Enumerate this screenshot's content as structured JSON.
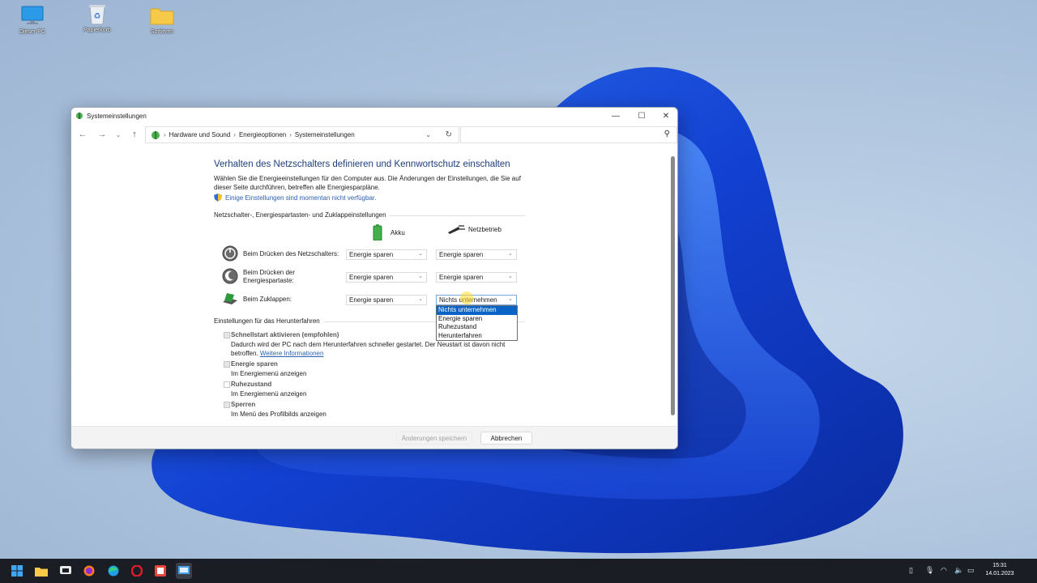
{
  "desktop": {
    "icons": [
      {
        "label": "Dieser PC"
      },
      {
        "label": "Papierkorb"
      },
      {
        "label": "Sortieren"
      }
    ]
  },
  "window": {
    "title": "Systemeinstellungen",
    "breadcrumb": [
      "Hardware und Sound",
      "Energieoptionen",
      "Systemeinstellungen"
    ],
    "search_placeholder": ""
  },
  "page": {
    "heading": "Verhalten des Netzschalters definieren und Kennwortschutz einschalten",
    "description": "Wählen Sie die Energieeinstellungen für den Computer aus. Die Änderungen der Einstellungen, die Sie auf dieser Seite durchführen, betreffen alle Energiesparpläne.",
    "unavailable_link": "Einige Einstellungen sind momentan nicht verfügbar.",
    "section_power": "Netzschalter-, Energiespartasten- und Zuklappeinstellungen",
    "col_battery": "Akku",
    "col_plugged": "Netzbetrieb",
    "rows": [
      {
        "label": "Beim Drücken des Netzschalters:",
        "battery": "Energie sparen",
        "plugged": "Energie sparen"
      },
      {
        "label": "Beim Drücken der Energiespartaste:",
        "battery": "Energie sparen",
        "plugged": "Energie sparen"
      },
      {
        "label": "Beim Zuklappen:",
        "battery": "Energie sparen",
        "plugged": "Nichts unternehmen"
      }
    ],
    "dropdown_options": [
      "Nichts unternehmen",
      "Energie sparen",
      "Ruhezustand",
      "Herunterfahren"
    ],
    "dropdown_selected": "Nichts unternehmen",
    "section_shutdown": "Einstellungen für das Herunterfahren",
    "shutdown_items": [
      {
        "title": "Schnellstart aktivieren (empfohlen)",
        "desc": "Dadurch wird der PC nach dem Herunterfahren schneller gestartet. Der Neustart ist davon nicht betroffen.",
        "link": "Weitere Informationen",
        "checked": true
      },
      {
        "title": "Energie sparen",
        "desc": "Im Energiemenü anzeigen",
        "checked": true
      },
      {
        "title": "Ruhezustand",
        "desc": "Im Energiemenü anzeigen",
        "checked": false
      },
      {
        "title": "Sperren",
        "desc": "Im Menü des Profilbilds anzeigen",
        "checked": true
      }
    ],
    "save_label": "Änderungen speichern",
    "cancel_label": "Abbrechen"
  },
  "taskbar": {
    "time": "15:31",
    "date": "14.01.2023"
  },
  "colors": {
    "accent": "#0a64c8",
    "heading": "#1e3e7a",
    "link": "#2c60b0",
    "taskbar": "#1a1d24"
  }
}
